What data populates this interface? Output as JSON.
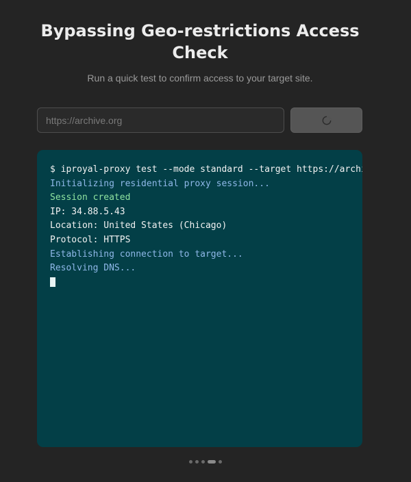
{
  "header": {
    "title": "Bypassing Geo-restrictions Access Check",
    "subtitle": "Run a quick test to confirm access to your target site."
  },
  "form": {
    "url_placeholder": "https://archive.org",
    "url_value": "",
    "run_button_icon": "spinner-icon",
    "run_button_state": "loading"
  },
  "terminal": {
    "lines": [
      {
        "text": "$ iproyal-proxy test --mode standard --target https://archive.org",
        "style": "command"
      },
      {
        "text": "Initializing residential proxy session...",
        "style": "info"
      },
      {
        "text": "Session created",
        "style": "success"
      },
      {
        "text": "IP: 34.88.5.43",
        "style": "plain"
      },
      {
        "text": "Location: United States (Chicago)",
        "style": "plain"
      },
      {
        "text": "Protocol: HTTPS",
        "style": "plain"
      },
      {
        "text": "Establishing connection to target...",
        "style": "info"
      },
      {
        "text": "Resolving DNS...",
        "style": "info"
      }
    ],
    "cursor_visible": true
  },
  "pager": {
    "count": 5,
    "active_index": 3
  },
  "colors": {
    "background": "#242424",
    "terminal_bg": "#033f47",
    "info_text": "#8fb8e8",
    "success_text": "#8fe3a0",
    "plain_text": "#f2f2f2"
  }
}
